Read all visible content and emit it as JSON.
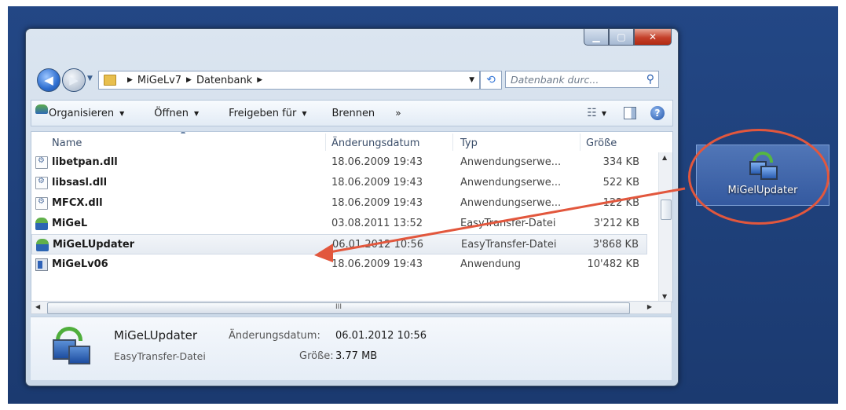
{
  "window": {
    "address": {
      "crumbs": [
        "MiGeLv7",
        "Datenbank"
      ]
    },
    "search": {
      "placeholder": "Datenbank durc..."
    }
  },
  "toolbar": {
    "organize": "Organisieren",
    "open": "Öffnen",
    "share": "Freigeben für",
    "burn": "Brennen",
    "more": "»"
  },
  "columns": {
    "name": "Name",
    "date": "Änderungsdatum",
    "type": "Typ",
    "size": "Größe"
  },
  "files": [
    {
      "name": "libetpan.dll",
      "date": "18.06.2009 19:43",
      "type": "Anwendungserwe...",
      "size": "334 KB",
      "icon": "dll-file-icon"
    },
    {
      "name": "libsasl.dll",
      "date": "18.06.2009 19:43",
      "type": "Anwendungserwe...",
      "size": "522 KB",
      "icon": "dll-file-icon"
    },
    {
      "name": "MFCX.dll",
      "date": "18.06.2009 19:43",
      "type": "Anwendungserwe...",
      "size": "122 KB",
      "icon": "dll-file-icon"
    },
    {
      "name": "MiGeL",
      "date": "03.08.2011 13:52",
      "type": "EasyTransfer-Datei",
      "size": "3'212 KB",
      "icon": "easytransfer-icon"
    },
    {
      "name": "MiGeLUpdater",
      "date": "06.01.2012 10:56",
      "type": "EasyTransfer-Datei",
      "size": "3'868 KB",
      "icon": "easytransfer-icon"
    },
    {
      "name": "MiGeLv06",
      "date": "18.06.2009 19:43",
      "type": "Anwendung",
      "size": "10'482 KB",
      "icon": "application-icon"
    }
  ],
  "details": {
    "name": "MiGeLUpdater",
    "type": "EasyTransfer-Datei",
    "date_label": "Änderungsdatum:",
    "date": "06.01.2012 10:56",
    "size_label": "Größe:",
    "size": "3.77 MB"
  },
  "scroll": {
    "h_thumb_grip": "III"
  },
  "desktop_icon": {
    "label": "MiGelUpdater"
  },
  "colors": {
    "desktop": "#1f3f78",
    "annotation": "#e2573d",
    "selection": "#e6ebf2"
  }
}
